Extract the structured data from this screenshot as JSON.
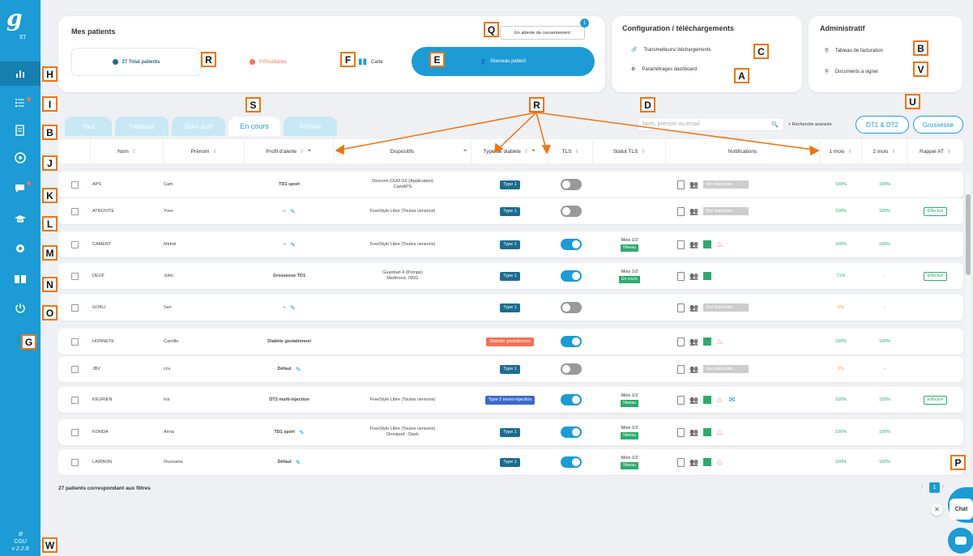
{
  "app": {
    "logo": "g",
    "logo_sub": "XT",
    "version": "v 2.2.8"
  },
  "sidebar": {
    "version_top": "CGU"
  },
  "annotations": {
    "H": "H",
    "I": "I",
    "B1": "B",
    "J": "J",
    "K": "K",
    "L": "L",
    "M": "M",
    "N": "N",
    "O": "O",
    "G": "G",
    "W": "W",
    "R1": "R",
    "F": "F",
    "E": "E",
    "Q": "Q",
    "C": "C",
    "A": "A",
    "B2": "B",
    "V": "V",
    "S": "S",
    "R2": "R",
    "D": "D",
    "U": "U",
    "P": "P"
  },
  "patients_card": {
    "title": "Mes patients",
    "total": "27 Total patients",
    "prioritaires": "0 Prioritaires",
    "carte": "Carte",
    "nouveau": "Nouveau patient",
    "consent": "En attente de consentement",
    "consent_badge": "1"
  },
  "config_card": {
    "title": "Configuration / téléchargements",
    "transmetteurs": "Transmetteurs/ déchargements",
    "parametrages": "Paramétrages dashboard"
  },
  "admin_card": {
    "title": "Administratif",
    "facturation": "Tableau de facturation",
    "documents": "Documents à signer"
  },
  "tabs": [
    "Tout",
    "Télésuivi",
    "Suivi actif",
    "En cours",
    "Archivé"
  ],
  "search": {
    "placeholder": "Nom, prénom ou email",
    "advanced": "+ Recherche avancée"
  },
  "filter_buttons": {
    "dt": "DT1 & DT2",
    "grossesse": "Grossesse"
  },
  "columns": [
    "Nom",
    "Prénom",
    "Profil d'alerte",
    "Dispositifs",
    "Type de diabète",
    "TLS",
    "Statut TLS",
    "Notifications",
    "1 mois",
    "2 mois",
    "Rappel AT"
  ],
  "rows": [
    {
      "nom": "APS",
      "prenom": "Cam",
      "profil": "TD1 sport",
      "dispositif": "Dexcom CGM G6 (Application)\nCamAPS",
      "type": "Type 1",
      "tls": false,
      "statut": "",
      "statut_tag": "",
      "notif": "Non disponible",
      "m1": "100%",
      "m2": "100%",
      "rappel": ""
    },
    {
      "nom": "ATROVITE",
      "prenom": "Yves",
      "profil": "--",
      "dispositif": "FreeStyle Libre (Toutes versions)",
      "type": "Type 1",
      "tls": false,
      "statut": "",
      "statut_tag": "",
      "notif": "Non disponible",
      "m1": "100%",
      "m2": "100%",
      "rappel": "Effectué"
    },
    {
      "nom": "CAMENT",
      "prenom": "Mehdi",
      "profil": "--",
      "dispositif": "FreeStyle Libre (Toutes versions)",
      "type": "Type 1",
      "tls": true,
      "statut": "Mois 1/2",
      "statut_tag": "Niveau",
      "notif": "",
      "m1": "100%",
      "m2": "100%",
      "rappel": ""
    },
    {
      "nom": "DEUF",
      "prenom": "John",
      "profil": "Grossesse TD1",
      "dispositif": "Guardian 4 (Pompe)\nMedtronic 780G",
      "type": "Type 1",
      "tls": true,
      "statut": "Mois 1/2",
      "statut_tag": "En cours",
      "notif": "",
      "m1": "71%",
      "m2": "-",
      "rappel": "Effectué"
    },
    {
      "nom": "GOKU",
      "prenom": "San",
      "profil": "--",
      "dispositif": "",
      "type": "Type 1",
      "tls": false,
      "statut": "",
      "statut_tag": "",
      "notif": "Non disponible",
      "m1": "0%",
      "m2": "-",
      "rappel": ""
    },
    {
      "nom": "HONNETE",
      "prenom": "Camille",
      "profil": "Diabète gestationnel",
      "dispositif": "",
      "type": "Diabète gestationnel",
      "tls": true,
      "statut": "",
      "statut_tag": "",
      "notif": "",
      "m1": "100%",
      "m2": "100%",
      "rappel": ""
    },
    {
      "nom": "JBV",
      "prenom": "ccv",
      "profil": "Défaut",
      "dispositif": "",
      "type": "Type 1",
      "tls": false,
      "statut": "",
      "statut_tag": "",
      "notif": "Non disponible",
      "m1": "0%",
      "m2": "-",
      "rappel": ""
    },
    {
      "nom": "KEURIEN",
      "prenom": "Iris",
      "profil": "DT2 multi-injection",
      "dispositif": "FreeStyle Libre (Toutes versions)",
      "type": "Type 2 mono-injection",
      "tls": true,
      "statut": "Mois 1/2",
      "statut_tag": "Niveau",
      "notif": "",
      "m1": "100%",
      "m2": "100%",
      "rappel": "Effectué"
    },
    {
      "nom": "KONDA",
      "prenom": "Anna",
      "profil": "TD1 sport",
      "dispositif": "FreeStyle Libre (Toutes versions)\nOmnipod - Dash",
      "type": "Type 1",
      "tls": true,
      "statut": "Mois 1/2",
      "statut_tag": "Niveau",
      "notif": "",
      "m1": "100%",
      "m2": "100%",
      "rappel": ""
    },
    {
      "nom": "LAIRBON",
      "prenom": "Oussama",
      "profil": "Défaut",
      "dispositif": "",
      "type": "Type 1",
      "tls": true,
      "statut": "Mois 1/2",
      "statut_tag": "Niveau",
      "notif": "",
      "m1": "100%",
      "m2": "100%",
      "rappel": ""
    }
  ],
  "footer": "27 patients correspondant aux filtres",
  "pagination": "1",
  "chat": "Chat",
  "colors": {
    "primary": "#1c9bd5",
    "green": "#2dab6f",
    "tag": "#1b6d8f",
    "orange": "#f0730e",
    "pink": "#f37055"
  }
}
